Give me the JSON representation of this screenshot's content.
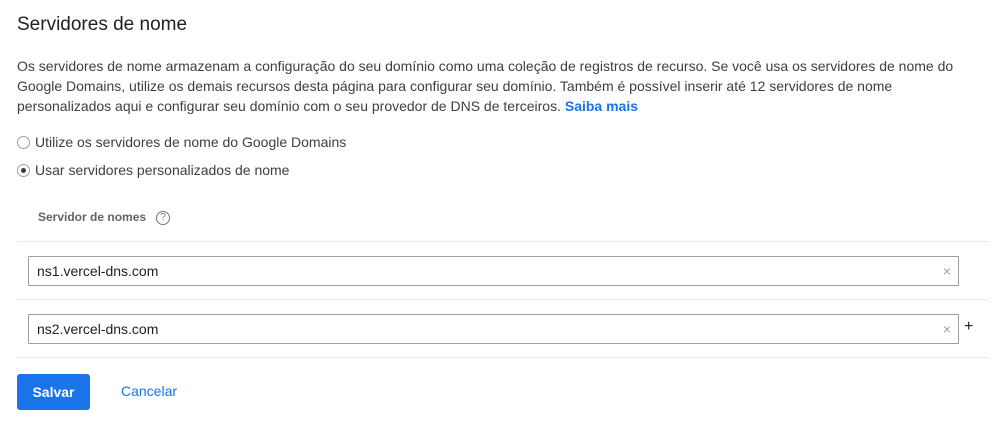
{
  "section": {
    "title": "Servidores de nome",
    "description": "Os servidores de nome armazenam a configuração do seu domínio como uma coleção de registros de recurso. Se você usa os servidores de nome do Google Domains, utilize os demais recursos desta página para configurar seu domínio. Também é possível inserir até 12 servidores de nome personalizados aqui e configurar seu domínio com o seu provedor de DNS de terceiros.",
    "learn_more": "Saiba mais"
  },
  "options": {
    "google": {
      "label": "Utilize os servidores de nome do Google Domains",
      "checked": false
    },
    "custom": {
      "label": "Usar servidores personalizados de nome",
      "checked": true
    }
  },
  "nameservers": {
    "header": "Servidor de nomes",
    "help_icon": "?",
    "clear_icon": "×",
    "add_icon": "+",
    "items": [
      {
        "value": "ns1.vercel-dns.com"
      },
      {
        "value": "ns2.vercel-dns.com"
      }
    ]
  },
  "actions": {
    "save": "Salvar",
    "cancel": "Cancelar"
  },
  "colors": {
    "accent": "#1a73e8",
    "text": "#202124",
    "divider": "#e8eaed"
  }
}
